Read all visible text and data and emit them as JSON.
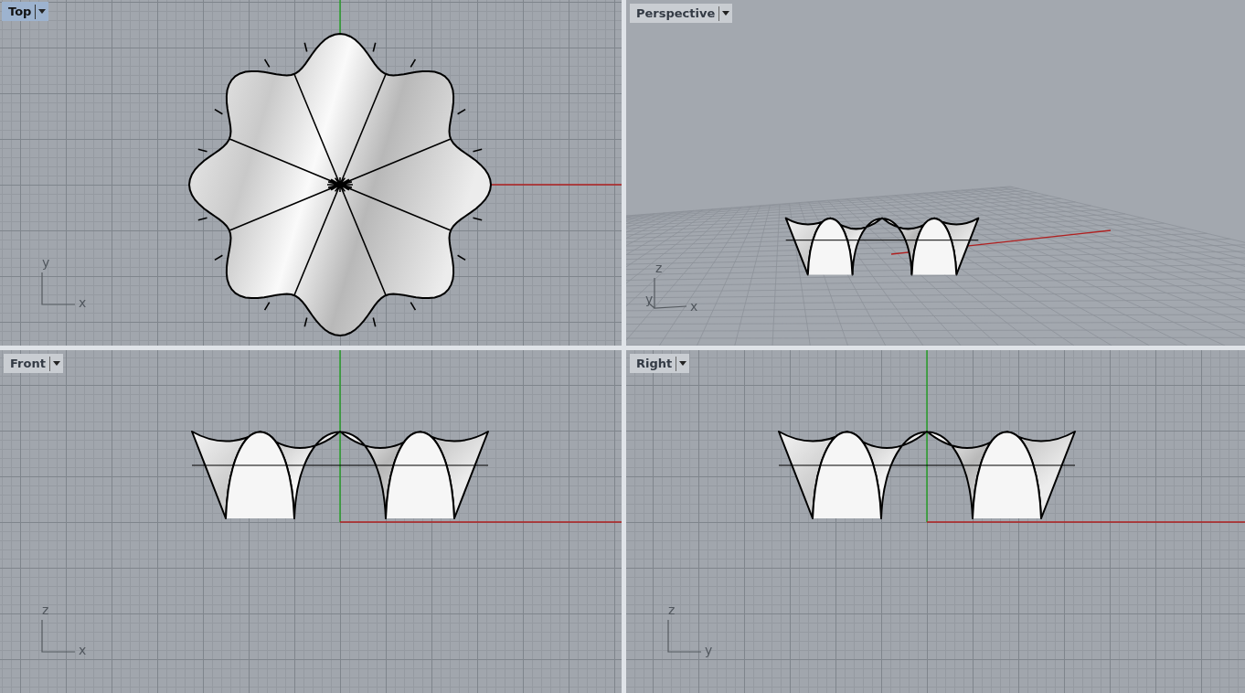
{
  "viewports": [
    {
      "title": "Top",
      "kind": "top",
      "selected": true,
      "triad": {
        "vertical": "y",
        "horizontal": "x"
      }
    },
    {
      "title": "Perspective",
      "kind": "perspective",
      "selected": false,
      "triad": {
        "vertical": "z",
        "depth": "y",
        "horizontal": "x"
      }
    },
    {
      "title": "Front",
      "kind": "front",
      "selected": false,
      "triad": {
        "vertical": "z",
        "horizontal": "x"
      }
    },
    {
      "title": "Right",
      "kind": "right",
      "selected": false,
      "triad": {
        "vertical": "z",
        "horizontal": "y"
      }
    }
  ]
}
